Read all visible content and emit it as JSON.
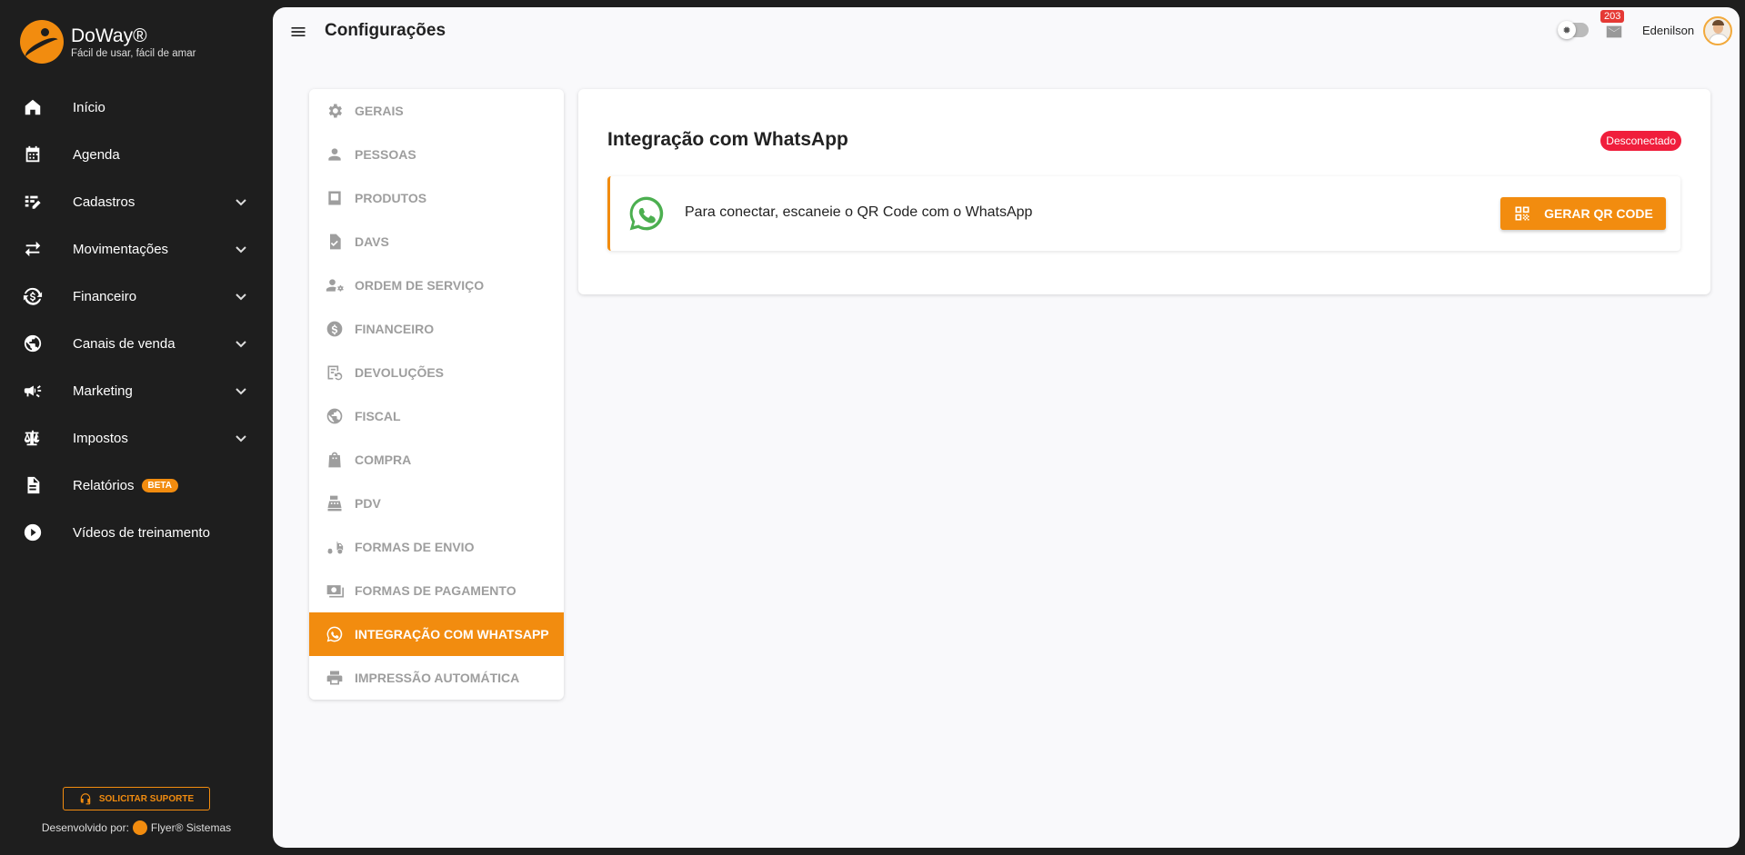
{
  "brand": {
    "name": "DoWay®",
    "tagline": "Fácil de usar, fácil de amar"
  },
  "sidebar": {
    "items": [
      {
        "label": "Início",
        "icon": "home-icon"
      },
      {
        "label": "Agenda",
        "icon": "calendar-icon"
      },
      {
        "label": "Cadastros",
        "icon": "edit-list-icon",
        "expandable": true
      },
      {
        "label": "Movimentações",
        "icon": "swap-icon",
        "expandable": true
      },
      {
        "label": "Financeiro",
        "icon": "currency-exchange-icon",
        "expandable": true
      },
      {
        "label": "Canais de venda",
        "icon": "globe-icon",
        "expandable": true
      },
      {
        "label": "Marketing",
        "icon": "megaphone-icon",
        "expandable": true
      },
      {
        "label": "Impostos",
        "icon": "scale-icon",
        "expandable": true
      },
      {
        "label": "Relatórios",
        "icon": "document-icon",
        "badge": "BETA"
      },
      {
        "label": "Vídeos de treinamento",
        "icon": "play-icon"
      }
    ],
    "support_button": "SOLICITAR SUPORTE",
    "developed_by_prefix": "Desenvolvido por:",
    "developed_by": "Flyer® Sistemas"
  },
  "header": {
    "title": "Configurações",
    "notifications_count": "203",
    "user_name": "Edenilson"
  },
  "settings_menu": {
    "items": [
      {
        "label": "GERAIS",
        "icon": "gear-icon"
      },
      {
        "label": "PESSOAS",
        "icon": "person-icon"
      },
      {
        "label": "PRODUTOS",
        "icon": "box-icon"
      },
      {
        "label": "DAVS",
        "icon": "file-check-icon"
      },
      {
        "label": "ORDEM DE SERVIÇO",
        "icon": "person-settings-icon"
      },
      {
        "label": "FINANCEIRO",
        "icon": "dollar-icon"
      },
      {
        "label": "DEVOLUÇÕES",
        "icon": "return-icon"
      },
      {
        "label": "FISCAL",
        "icon": "globe-fiscal-icon"
      },
      {
        "label": "COMPRA",
        "icon": "shopping-bag-icon"
      },
      {
        "label": "PDV",
        "icon": "register-icon"
      },
      {
        "label": "FORMAS DE ENVIO",
        "icon": "truck-icon"
      },
      {
        "label": "FORMAS DE PAGAMENTO",
        "icon": "money-icon"
      },
      {
        "label": "INTEGRAÇÃO COM WHATSAPP",
        "icon": "whatsapp-icon",
        "active": true
      },
      {
        "label": "IMPRESSÃO AUTOMÁTICA",
        "icon": "printer-icon"
      }
    ]
  },
  "whatsapp": {
    "title": "Integração com WhatsApp",
    "status": "Desconectado",
    "instruction": "Para conectar, escaneie o QR Code com o WhatsApp",
    "button_label": "GERAR QR CODE"
  },
  "colors": {
    "accent": "#f28c0f",
    "sidebar_bg": "#1e1e1e",
    "status_disconnected": "#f01e3c",
    "whatsapp_green": "#4caf50"
  }
}
